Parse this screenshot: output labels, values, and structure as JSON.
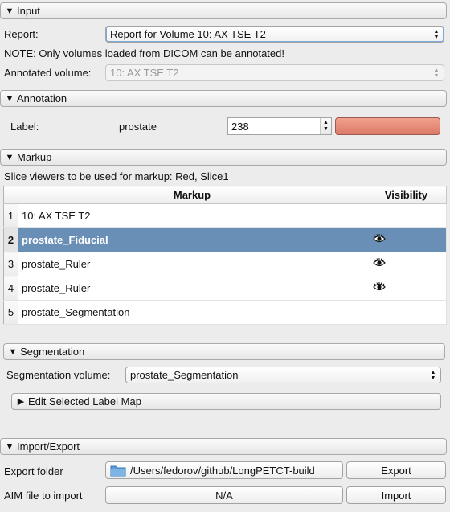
{
  "input": {
    "header": "Input",
    "report_label": "Report:",
    "report_value": "Report for Volume 10: AX TSE T2",
    "note": "NOTE: Only volumes loaded from DICOM can be annotated!",
    "annotated_label": "Annotated volume:",
    "annotated_value": "10: AX TSE T2"
  },
  "annotation": {
    "header": "Annotation",
    "label_label": "Label:",
    "label_name": "prostate",
    "label_value": "238",
    "swatch_color": "#e98a77"
  },
  "markup": {
    "header": "Markup",
    "slice_viewers": "Slice viewers to be used for markup: Red, Slice1",
    "columns": [
      "Markup",
      "Visibility"
    ],
    "rows": [
      {
        "num": "1",
        "name": "10: AX TSE T2",
        "visible": false
      },
      {
        "num": "2",
        "name": "prostate_Fiducial",
        "visible": true,
        "selected": true
      },
      {
        "num": "3",
        "name": "prostate_Ruler",
        "visible": true
      },
      {
        "num": "4",
        "name": "prostate_Ruler",
        "visible": true
      },
      {
        "num": "5",
        "name": "prostate_Segmentation",
        "visible": false
      }
    ]
  },
  "segmentation": {
    "header": "Segmentation",
    "volume_label": "Segmentation volume:",
    "volume_value": "prostate_Segmentation",
    "edit_label": "Edit Selected Label Map"
  },
  "import_export": {
    "header": "Import/Export",
    "export_folder_label": "Export folder",
    "export_folder_value": "/Users/fedorov/github/LongPETCT-build",
    "export_button": "Export",
    "aim_label": "AIM file to import",
    "aim_value": "N/A",
    "import_button": "Import"
  },
  "colors": {
    "selection": "#6a8fb7",
    "folder": "#5a9bd8"
  }
}
